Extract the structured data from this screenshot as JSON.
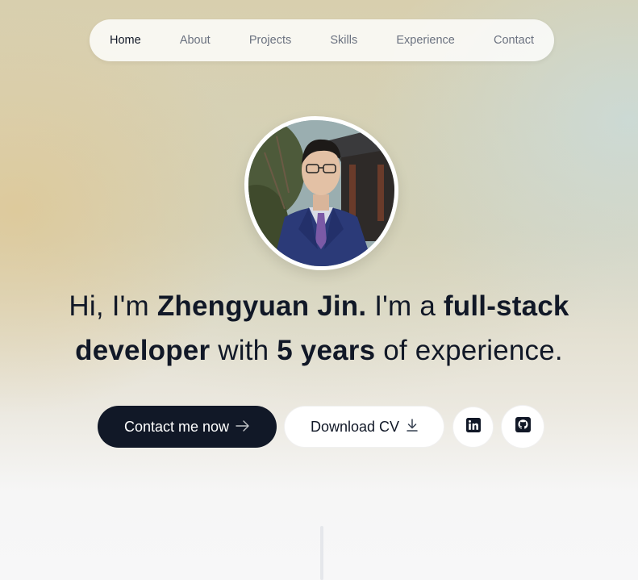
{
  "nav": {
    "items": [
      {
        "label": "Home",
        "active": true
      },
      {
        "label": "About"
      },
      {
        "label": "Projects"
      },
      {
        "label": "Skills"
      },
      {
        "label": "Experience"
      },
      {
        "label": "Contact"
      }
    ]
  },
  "hero": {
    "headline": {
      "part1": "Hi, I'm ",
      "name": "Zhengyuan Jin.",
      "part2": " I'm a ",
      "role": "full-stack developer",
      "part3": " with ",
      "years": "5 years",
      "part4": " of experience."
    },
    "buttons": {
      "contact_label": "Contact me now",
      "contact_icon": "arrow-right-icon",
      "cv_label": "Download CV",
      "cv_icon": "download-icon",
      "linkedin_icon": "linkedin-icon",
      "github_icon": "github-icon"
    }
  },
  "colors": {
    "primary": "#111827",
    "muted": "#6b7280",
    "divider": "#e5e7eb"
  }
}
